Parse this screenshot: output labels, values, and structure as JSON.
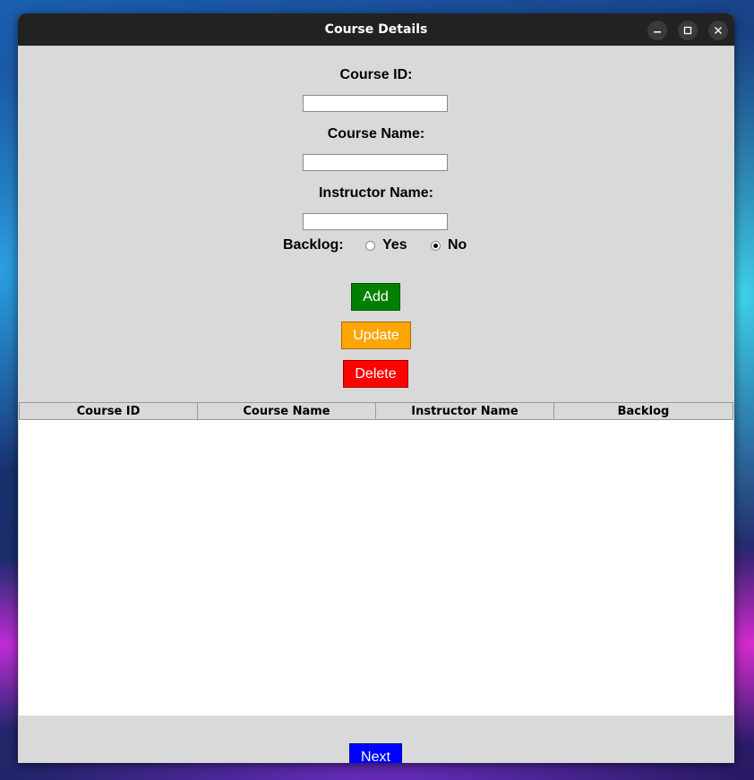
{
  "window": {
    "title": "Course Details"
  },
  "form": {
    "course_id_label": "Course ID:",
    "course_id_value": "",
    "course_name_label": "Course Name:",
    "course_name_value": "",
    "instructor_label": "Instructor Name:",
    "instructor_value": "",
    "backlog_label": "Backlog:",
    "backlog_options": [
      "Yes",
      "No"
    ],
    "backlog_selected": "No"
  },
  "buttons": {
    "add": "Add",
    "update": "Update",
    "delete": "Delete",
    "next": "Next"
  },
  "colors": {
    "add": "#008000",
    "update": "#ffa500",
    "delete": "#ff0000",
    "next": "#0000ff"
  },
  "table": {
    "columns": [
      "Course ID",
      "Course Name",
      "Instructor Name",
      "Backlog"
    ],
    "rows": []
  }
}
